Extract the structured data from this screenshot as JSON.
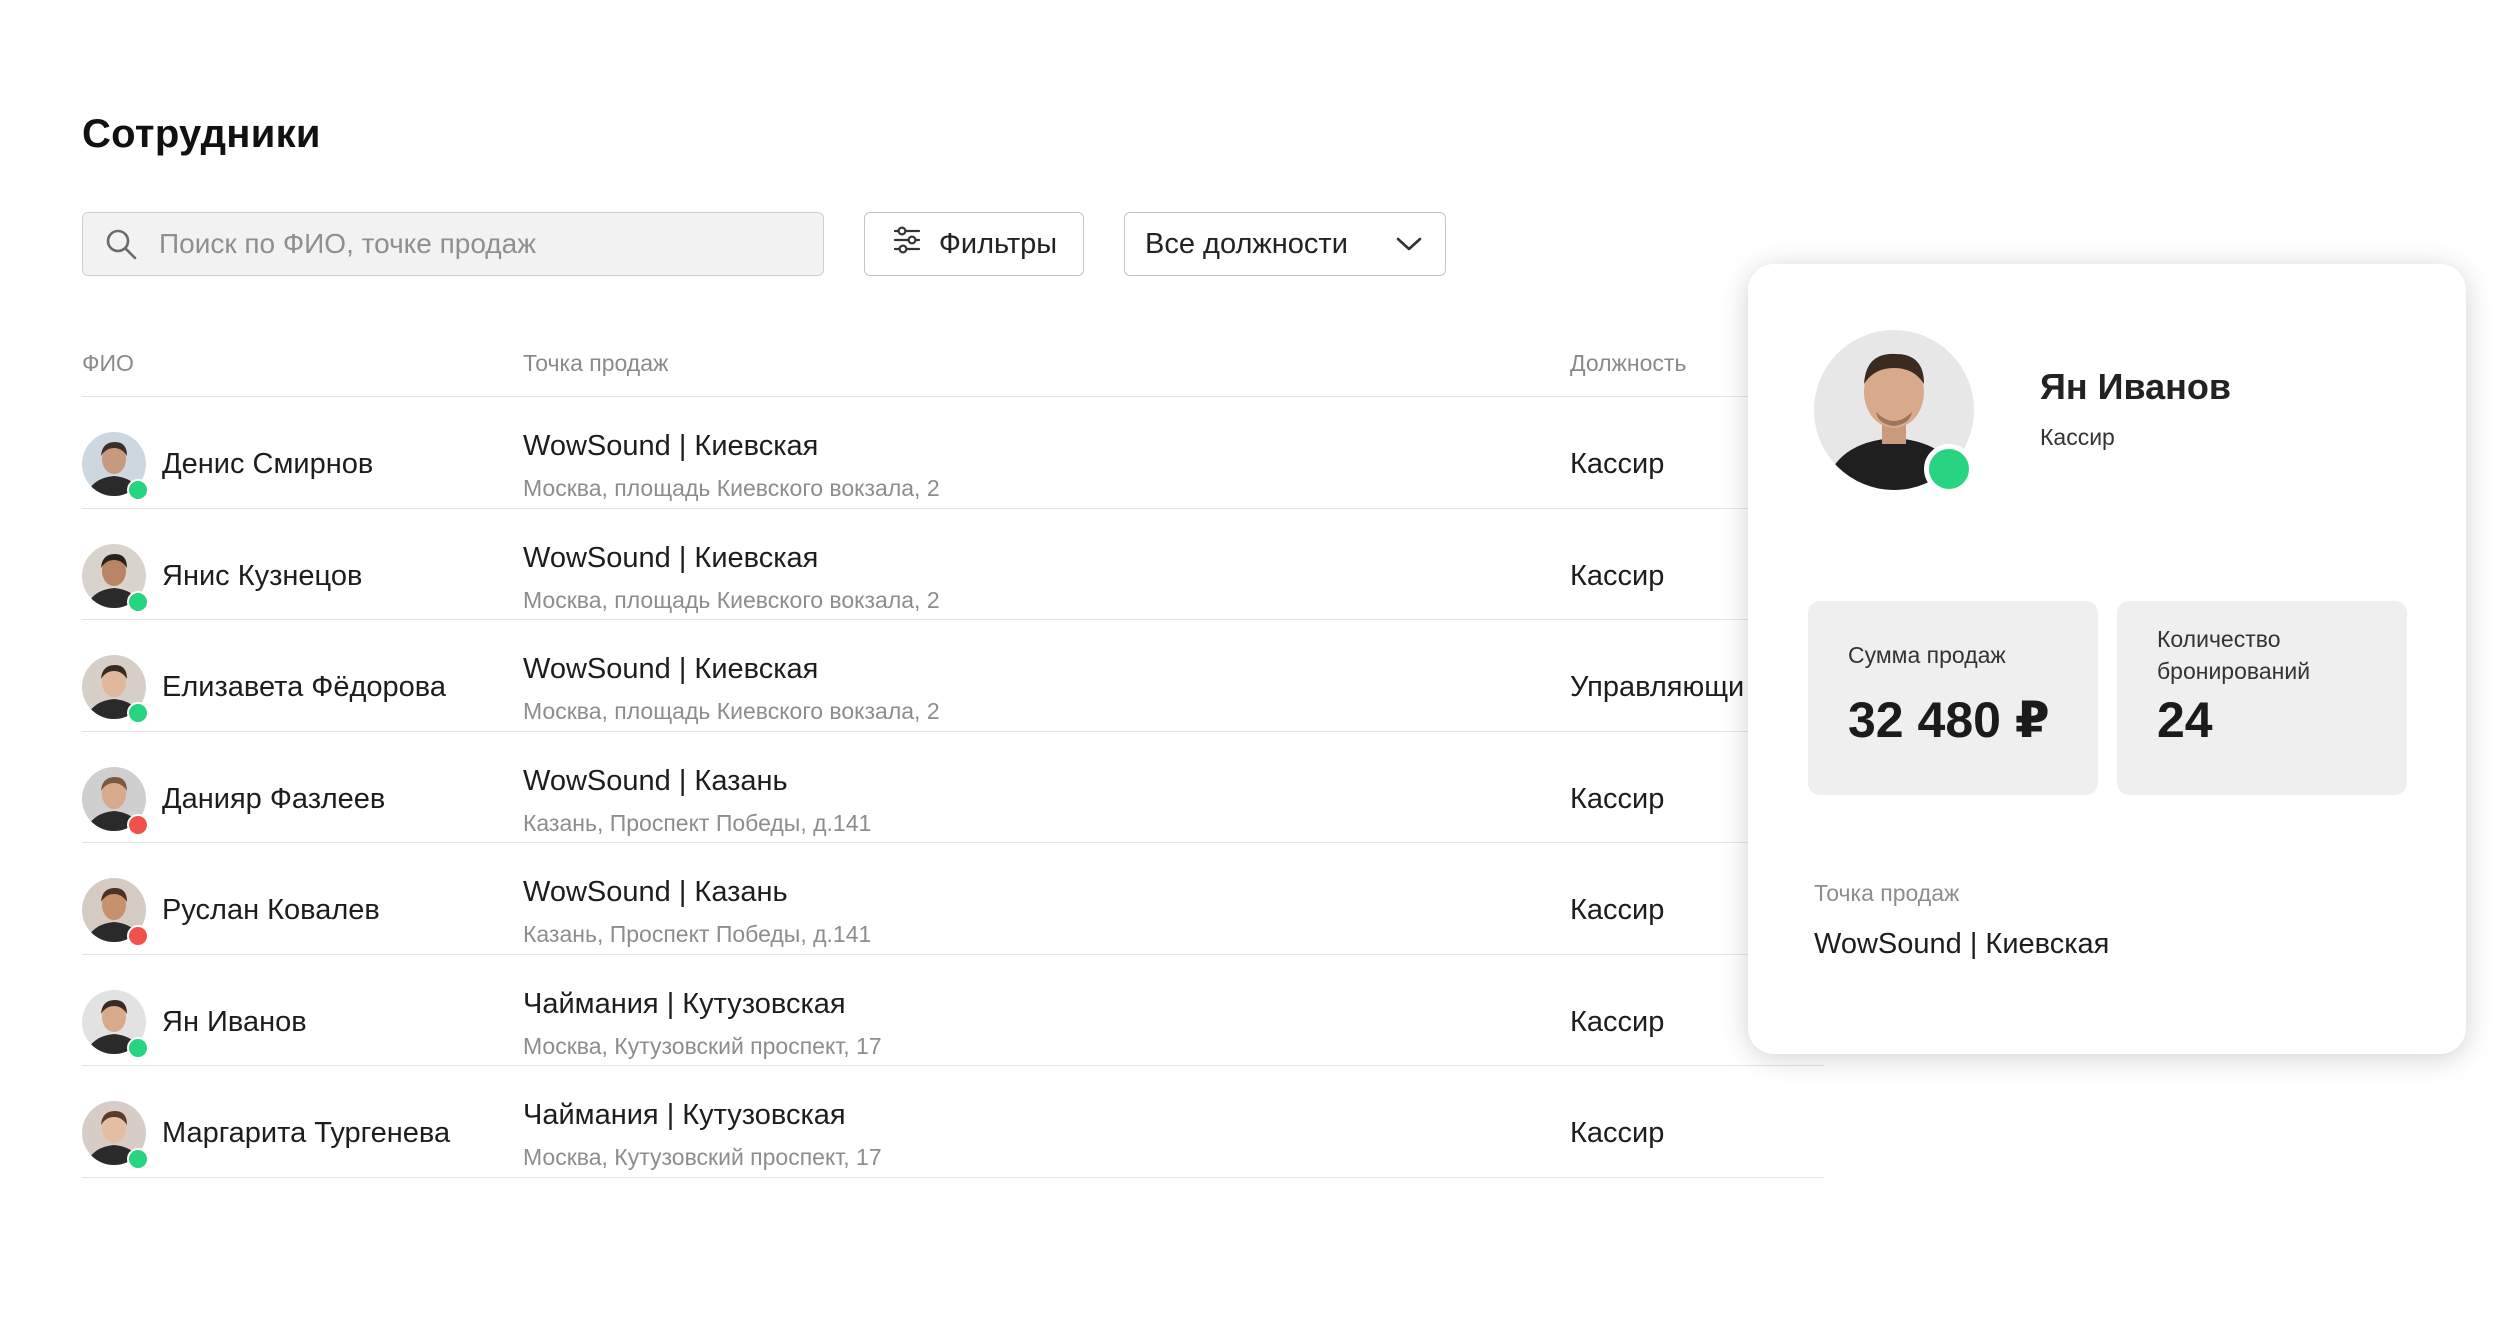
{
  "page": {
    "title": "Сотрудники"
  },
  "toolbar": {
    "search_placeholder": "Поиск по ФИО, точке продаж",
    "search_value": "",
    "filters_label": "Фильтры",
    "role_select_value": "Все должности"
  },
  "table": {
    "headers": {
      "name": "ФИО",
      "point": "Точка продаж",
      "role": "Должность"
    },
    "rows": [
      {
        "name": "Денис Смирнов",
        "point": "WowSound | Киевская",
        "address": "Москва, площадь Киевского вокзала, 2",
        "role": "Кассир",
        "status": "online"
      },
      {
        "name": "Янис Кузнецов",
        "point": "WowSound | Киевская",
        "address": "Москва, площадь Киевского вокзала, 2",
        "role": "Кассир",
        "status": "online"
      },
      {
        "name": "Елизавета Фёдорова",
        "point": "WowSound | Киевская",
        "address": "Москва, площадь Киевского вокзала, 2",
        "role": "Управляющи",
        "status": "online"
      },
      {
        "name": "Данияр Фазлеев",
        "point": "WowSound | Казань",
        "address": "Казань, Проспект Победы, д.141",
        "role": "Кассир",
        "status": "offline"
      },
      {
        "name": "Руслан Ковалев",
        "point": "WowSound | Казань",
        "address": "Казань, Проспект Победы, д.141",
        "role": "Кассир",
        "status": "offline"
      },
      {
        "name": "Ян Иванов",
        "point": "Чаймания | Кутузовская",
        "address": "Москва, Кутузовский проспект, 17",
        "role": "Кассир",
        "status": "online"
      },
      {
        "name": "Маргарита Тургенева",
        "point": "Чаймания | Кутузовская",
        "address": "Москва, Кутузовский проспект, 17",
        "role": "Кассир",
        "status": "online"
      }
    ]
  },
  "card": {
    "name": "Ян Иванов",
    "role": "Кассир",
    "status": "online",
    "sales_label": "Сумма продаж",
    "sales_value": "32 480 ₽",
    "bookings_label": "Количество бронирований",
    "bookings_value": "24",
    "point_label": "Точка продаж",
    "point_value": "WowSound | Киевская"
  },
  "icons": {
    "search": "search-icon",
    "filters": "sliders-icon",
    "dropdown": "chevron-down-icon"
  },
  "colors": {
    "status_online": "#27d47f",
    "status_offline": "#f0524a",
    "stat_bg": "#efefef",
    "search_bg": "#f2f2f2"
  }
}
